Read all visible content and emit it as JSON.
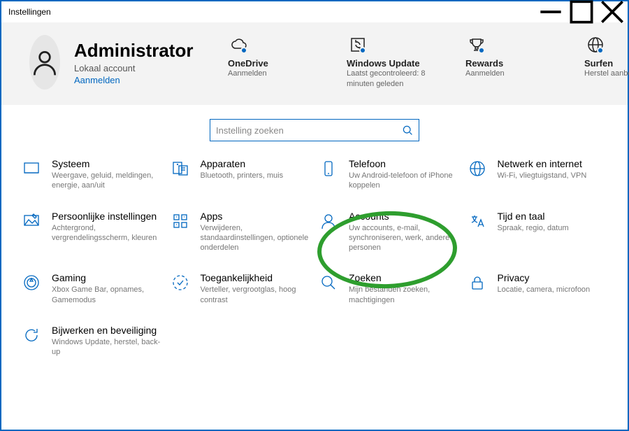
{
  "window": {
    "title": "Instellingen"
  },
  "user": {
    "name": "Administrator",
    "subtitle": "Lokaal account",
    "signin": "Aanmelden"
  },
  "header_items": [
    {
      "icon": "cloud",
      "title": "OneDrive",
      "subtitle": "Aanmelden"
    },
    {
      "icon": "sync",
      "title": "Windows Update",
      "subtitle": "Laatst gecontroleerd: 8 minuten geleden"
    },
    {
      "icon": "trophy",
      "title": "Rewards",
      "subtitle": "Aanmelden"
    },
    {
      "icon": "globe",
      "title": "Surfen",
      "subtitle": "Herstel aanbevolen"
    }
  ],
  "search": {
    "placeholder": "Instelling zoeken"
  },
  "categories": [
    {
      "icon": "monitor",
      "title": "Systeem",
      "subtitle": "Weergave, geluid, meldingen, energie, aan/uit"
    },
    {
      "icon": "devices",
      "title": "Apparaten",
      "subtitle": "Bluetooth, printers, muis"
    },
    {
      "icon": "phone",
      "title": "Telefoon",
      "subtitle": "Uw Android-telefoon of iPhone koppelen"
    },
    {
      "icon": "globe",
      "title": "Netwerk en internet",
      "subtitle": "Wi-Fi, vliegtuigstand, VPN"
    },
    {
      "icon": "brush",
      "title": "Persoonlijke instellingen",
      "subtitle": "Achtergrond, vergrendelingsscherm, kleuren"
    },
    {
      "icon": "apps",
      "title": "Apps",
      "subtitle": "Verwijderen, standaardinstellingen, optionele onderdelen"
    },
    {
      "icon": "person",
      "title": "Accounts",
      "subtitle": "Uw accounts, e-mail, synchroniseren, werk, andere personen"
    },
    {
      "icon": "lang",
      "title": "Tijd en taal",
      "subtitle": "Spraak, regio, datum"
    },
    {
      "icon": "gaming",
      "title": "Gaming",
      "subtitle": "Xbox Game Bar, opnames, Gamemodus"
    },
    {
      "icon": "access",
      "title": "Toegankelijkheid",
      "subtitle": "Verteller, vergrootglas, hoog contrast"
    },
    {
      "icon": "search",
      "title": "Zoeken",
      "subtitle": "Mijn bestanden zoeken, machtigingen"
    },
    {
      "icon": "lock",
      "title": "Privacy",
      "subtitle": "Locatie, camera, microfoon"
    },
    {
      "icon": "refresh",
      "title": "Bijwerken en beveiliging",
      "subtitle": "Windows Update, herstel, back-up"
    }
  ]
}
